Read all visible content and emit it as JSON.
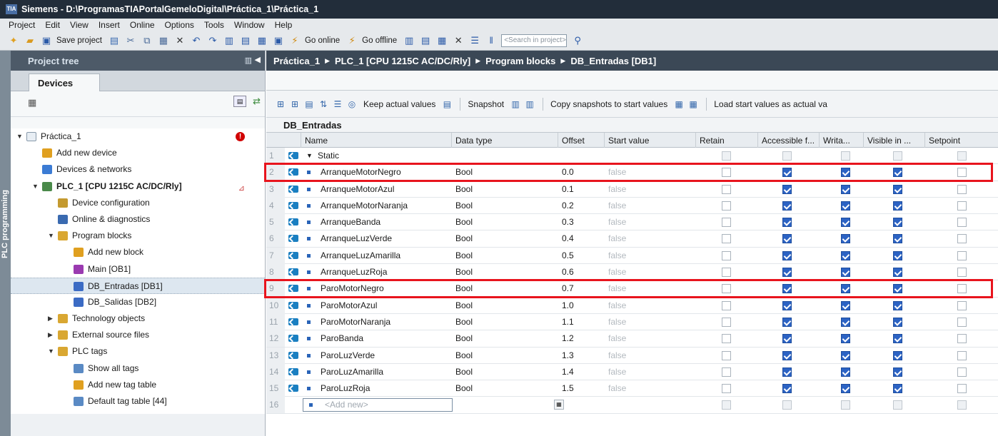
{
  "window": {
    "title": "Siemens - D:\\ProgramasTIAPortalGemeloDigital\\Práctica_1\\Práctica_1",
    "app_icon": "TIA"
  },
  "menu": [
    "Project",
    "Edit",
    "View",
    "Insert",
    "Online",
    "Options",
    "Tools",
    "Window",
    "Help"
  ],
  "toolbar": {
    "save_label": "Save project",
    "go_online_label": "Go online",
    "go_offline_label": "Go offline",
    "search_placeholder": "<Search in project>"
  },
  "left_strip": {
    "label": "PLC programming"
  },
  "project_tree": {
    "header": "Project tree",
    "tab": "Devices",
    "items": [
      {
        "label": "Práctica_1",
        "level": 0,
        "arrow": "▼",
        "icon": "project-icon",
        "badge": "!"
      },
      {
        "label": "Add new device",
        "level": 1,
        "arrow": "",
        "icon": "add-device-icon"
      },
      {
        "label": "Devices & networks",
        "level": 1,
        "arrow": "",
        "icon": "network-icon"
      },
      {
        "label": "PLC_1 [CPU 1215C AC/DC/Rly]",
        "level": 1,
        "arrow": "▼",
        "icon": "plc-icon",
        "bold": true
      },
      {
        "label": "Device configuration",
        "level": 2,
        "arrow": "",
        "icon": "device-config-icon"
      },
      {
        "label": "Online & diagnostics",
        "level": 2,
        "arrow": "",
        "icon": "diagnostics-icon"
      },
      {
        "label": "Program blocks",
        "level": 2,
        "arrow": "▼",
        "icon": "folder-icon"
      },
      {
        "label": "Add new block",
        "level": 3,
        "arrow": "",
        "icon": "add-block-icon"
      },
      {
        "label": "Main [OB1]",
        "level": 3,
        "arrow": "",
        "icon": "ob-icon"
      },
      {
        "label": "DB_Entradas [DB1]",
        "level": 3,
        "arrow": "",
        "icon": "db-icon",
        "selected": true
      },
      {
        "label": "DB_Salidas [DB2]",
        "level": 3,
        "arrow": "",
        "icon": "db-icon"
      },
      {
        "label": "Technology objects",
        "level": 2,
        "arrow": "▶",
        "icon": "folder-icon"
      },
      {
        "label": "External source files",
        "level": 2,
        "arrow": "▶",
        "icon": "folder-icon"
      },
      {
        "label": "PLC tags",
        "level": 2,
        "arrow": "▼",
        "icon": "folder-icon"
      },
      {
        "label": "Show all tags",
        "level": 3,
        "arrow": "",
        "icon": "tag-table-icon"
      },
      {
        "label": "Add new tag table",
        "level": 3,
        "arrow": "",
        "icon": "add-block-icon"
      },
      {
        "label": "Default tag table [44]",
        "level": 3,
        "arrow": "",
        "icon": "tag-table-icon"
      }
    ]
  },
  "breadcrumb": [
    "Práctica_1",
    "PLC_1 [CPU 1215C AC/DC/Rly]",
    "Program blocks",
    "DB_Entradas [DB1]"
  ],
  "editor_toolbar": {
    "keep_actual": "Keep actual values",
    "snapshot": "Snapshot",
    "copy_snapshots": "Copy snapshots to start values",
    "load_start": "Load start values as actual va"
  },
  "db": {
    "title": "DB_Entradas",
    "columns": [
      "Name",
      "Data type",
      "Offset",
      "Start value",
      "Retain",
      "Accessible f...",
      "Writa...",
      "Visible in ...",
      "Setpoint"
    ],
    "static_label": "Static",
    "rows": [
      {
        "n": "2",
        "name": "ArranqueMotorNegro",
        "type": "Bool",
        "offset": "0.0",
        "start": "false",
        "highlight": true
      },
      {
        "n": "3",
        "name": "ArranqueMotorAzul",
        "type": "Bool",
        "offset": "0.1",
        "start": "false"
      },
      {
        "n": "4",
        "name": "ArranqueMotorNaranja",
        "type": "Bool",
        "offset": "0.2",
        "start": "false"
      },
      {
        "n": "5",
        "name": "ArranqueBanda",
        "type": "Bool",
        "offset": "0.3",
        "start": "false"
      },
      {
        "n": "6",
        "name": "ArranqueLuzVerde",
        "type": "Bool",
        "offset": "0.4",
        "start": "false"
      },
      {
        "n": "7",
        "name": "ArranqueLuzAmarilla",
        "type": "Bool",
        "offset": "0.5",
        "start": "false"
      },
      {
        "n": "8",
        "name": "ArranqueLuzRoja",
        "type": "Bool",
        "offset": "0.6",
        "start": "false"
      },
      {
        "n": "9",
        "name": "ParoMotorNegro",
        "type": "Bool",
        "offset": "0.7",
        "start": "false",
        "highlight": true
      },
      {
        "n": "10",
        "name": "ParoMotorAzul",
        "type": "Bool",
        "offset": "1.0",
        "start": "false"
      },
      {
        "n": "11",
        "name": "ParoMotorNaranja",
        "type": "Bool",
        "offset": "1.1",
        "start": "false"
      },
      {
        "n": "12",
        "name": "ParoBanda",
        "type": "Bool",
        "offset": "1.2",
        "start": "false"
      },
      {
        "n": "13",
        "name": "ParoLuzVerde",
        "type": "Bool",
        "offset": "1.3",
        "start": "false"
      },
      {
        "n": "14",
        "name": "ParoLuzAmarilla",
        "type": "Bool",
        "offset": "1.4",
        "start": "false"
      },
      {
        "n": "15",
        "name": "ParoLuzRoja",
        "type": "Bool",
        "offset": "1.5",
        "start": "false"
      }
    ],
    "add_new_placeholder": "<Add new>",
    "row1_num": "1",
    "row16_num": "16"
  },
  "colors": {
    "highlight": "#e8141d",
    "checkbox_on": "#2c63c4",
    "title_bar": "#222d3a"
  }
}
